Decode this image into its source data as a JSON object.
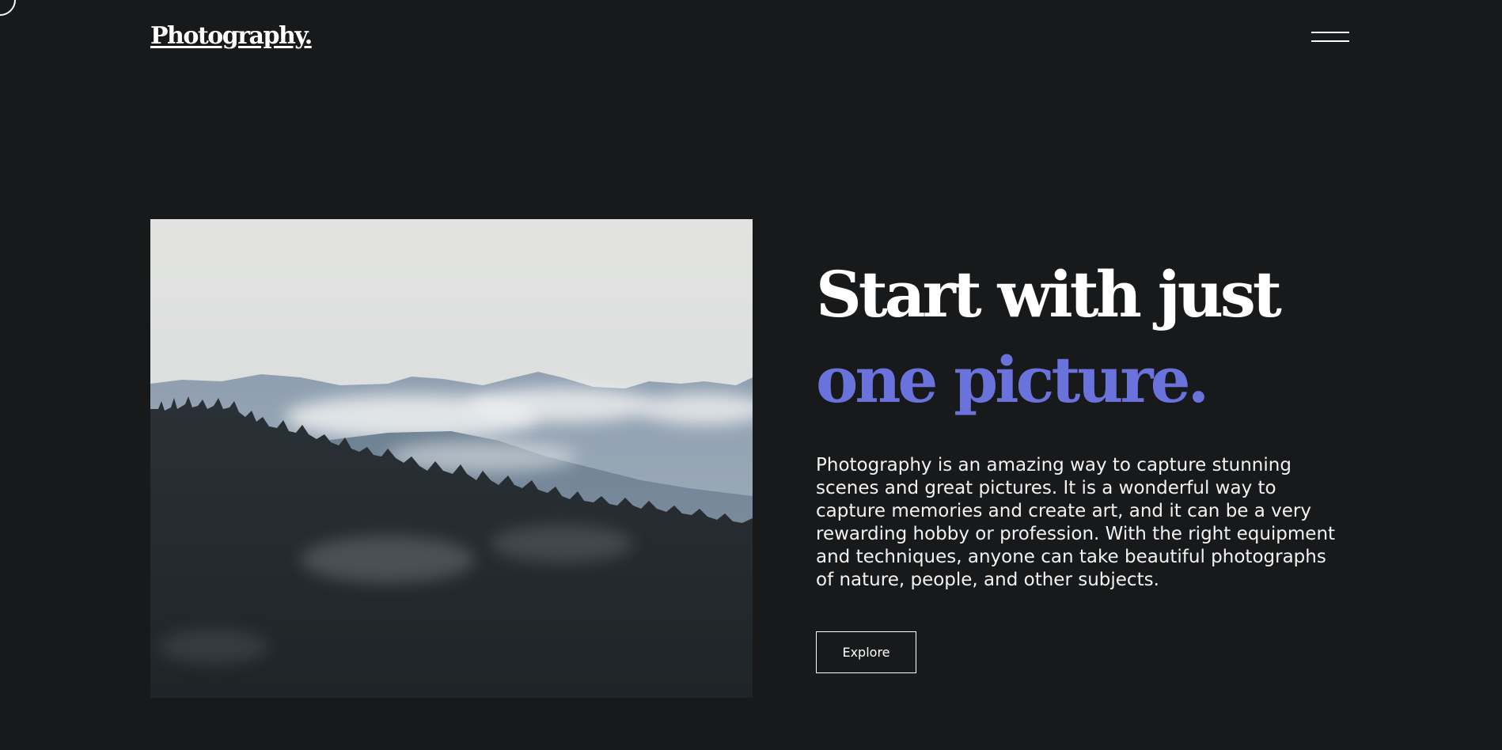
{
  "header": {
    "logo_text": "Photography.",
    "menu_icon": "hamburger-menu-icon"
  },
  "hero": {
    "image_alt": "misty-forest-mountains",
    "headline_line1": "Start with just",
    "headline_line2": "one picture.",
    "description": "Photography is an amazing way to capture stunning scenes and great pictures. It is a wonderful way to capture memories and create art, and it can be a very rewarding hobby or profession. With the right equipment and techniques, anyone can take beautiful photographs of nature, people, and other subjects.",
    "explore_label": "Explore"
  },
  "colors": {
    "background": "#18191b",
    "text": "#ffffff",
    "accent": "#6a72dc"
  }
}
